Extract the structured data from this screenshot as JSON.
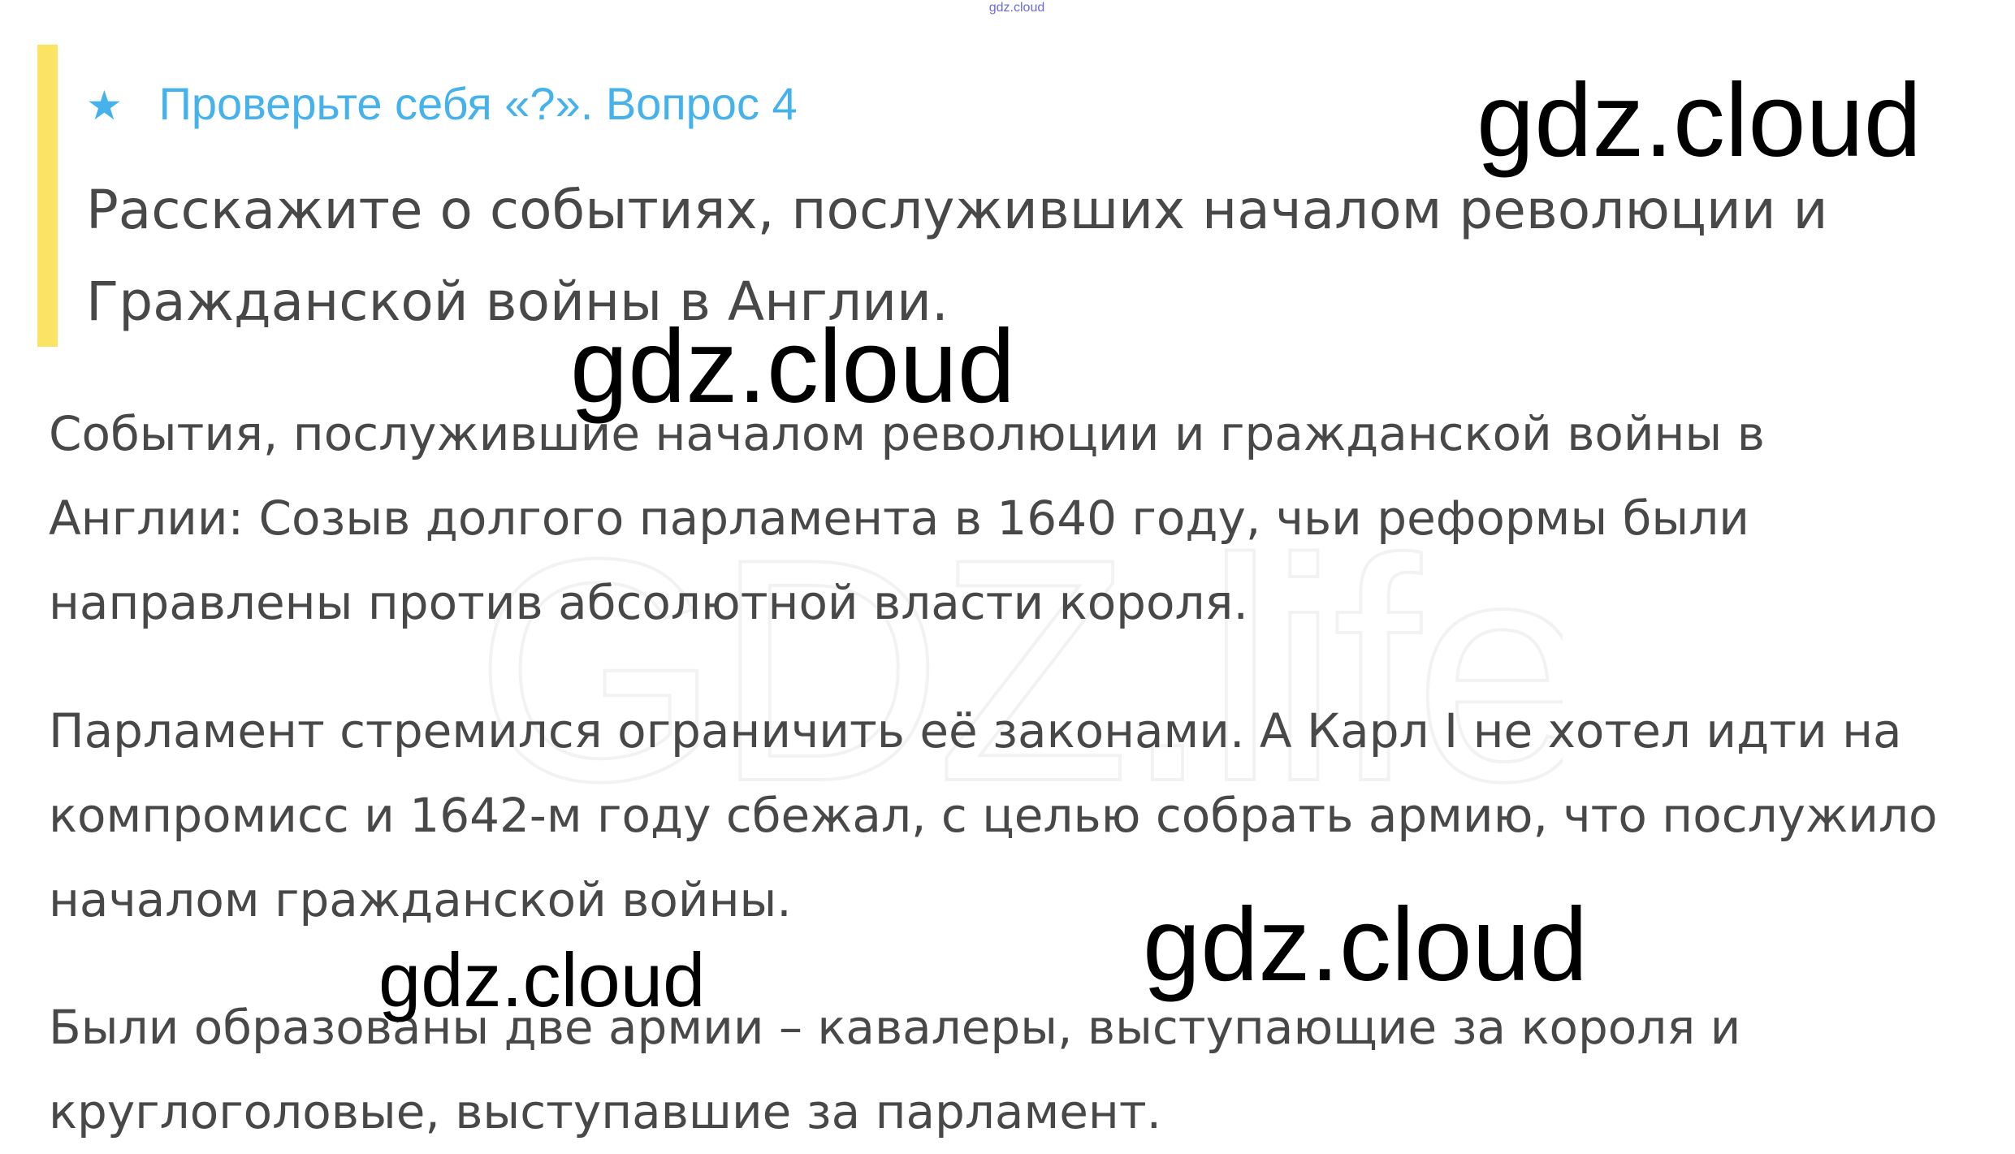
{
  "top_mark": "gdz.cloud",
  "question": {
    "icon": "star-icon",
    "header": "Проверьте себя «?». Вопрос 4",
    "text": "Расскажите о событиях, послуживших началом революции и Гражданской войны в Англии."
  },
  "answers": [
    "События, послужившие началом революции и гражданской войны в Англии: Созыв долгого парламента в 1640 году, чьи реформы были направлены против абсолютной власти короля.",
    "Парламент стремился ограничить её законами. А Карл I не хотел идти на компромисс и 1642-м году сбежал, с целью собрать армию, что послужило началом гражданской войны.",
    "Были образованы две армии – кавалеры, выступающие за короля и круглоголовые, выступавшие за парламент."
  ],
  "watermarks": [
    "gdz.cloud",
    "gdz.cloud",
    "gdz.cloud",
    "gdz.cloud"
  ],
  "faint_watermark": "GDZ.life",
  "colors": {
    "accent_bar": "#fbe464",
    "question_header": "#45b2ec",
    "body_text": "#484848",
    "watermark": "#000000"
  }
}
